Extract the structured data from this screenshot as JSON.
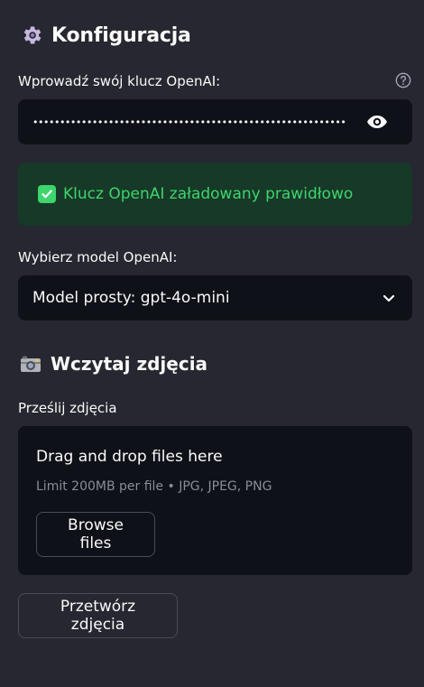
{
  "config": {
    "heading": "Konfiguracja",
    "api_key_label": "Wprowadź swój klucz OpenAI:",
    "api_key_masked": "••••••••••••••••••••••••••••••••••••••••••••••••••••••••••••••••••",
    "success_message": "Klucz OpenAI załadowany prawidłowo",
    "model_label": "Wybierz model OpenAI:",
    "model_selected": "Model prosty: gpt-4o-mini"
  },
  "upload": {
    "heading": "Wczytaj zdjęcia",
    "label": "Prześlij zdjęcia",
    "drop_title": "Drag and drop files here",
    "drop_limit": "Limit 200MB per file • JPG, JPEG, PNG",
    "browse_label": "Browse files"
  },
  "actions": {
    "process_label": "Przetwórz zdjęcia"
  },
  "colors": {
    "background": "#262730",
    "input_bg": "#0e1117",
    "success_bg": "#173928",
    "success_text": "#3dd56d"
  }
}
